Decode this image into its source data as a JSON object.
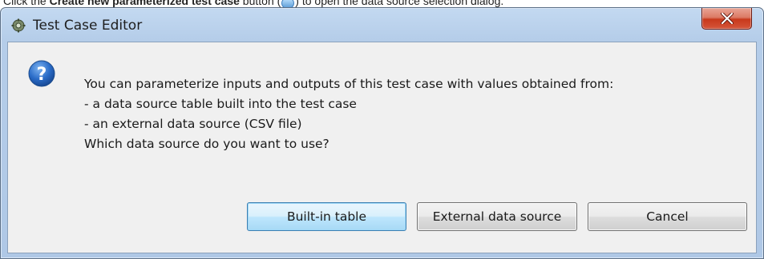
{
  "instruction": {
    "prefix": "Click the ",
    "bold": "Create new parameterized test case",
    "middle": " button (",
    "suffix": ") to open the data source selection dialog."
  },
  "window": {
    "title": "Test Case Editor",
    "close_glyph": "X"
  },
  "dialog": {
    "icon": "question-icon",
    "message_lines": [
      "You can parameterize inputs and outputs of this test case with values obtained from:",
      "- a data source table built into the test case",
      "- an external data source (CSV file)",
      "Which data source do you want to use?"
    ],
    "buttons": {
      "builtin": "Built-in table",
      "external": "External data source",
      "cancel": "Cancel"
    }
  },
  "colors": {
    "accent": "#3c7fb1",
    "close_button": "#c8391c",
    "question_icon": "#1f5fb8"
  }
}
